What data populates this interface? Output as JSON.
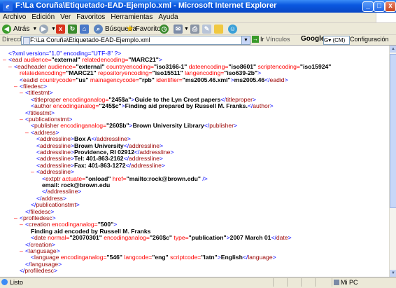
{
  "window": {
    "title": "F:\\La Coruña\\Etiquetado-EAD-Ejemplo.xml - Microsoft Internet Explorer",
    "app_icon": "e",
    "minimize": "_",
    "maximize": "□",
    "close": "x"
  },
  "menu": [
    "Archivo",
    "Edición",
    "Ver",
    "Favoritos",
    "Herramientas",
    "Ayuda"
  ],
  "toolbar": {
    "back_label": "Atrás",
    "search_label": "Búsqueda",
    "favorites_label": "Favoritos"
  },
  "address": {
    "label": "Dirección",
    "value": "F:\\La Coruña\\Etiquetado-EAD-Ejemplo.xml",
    "go_label": "Ir",
    "links_label": "Vínculos",
    "google_label": "Google",
    "google_search": "G▾ (CM)",
    "config_label": "Configuración"
  },
  "xml": {
    "l01": {
      "a": "<?xml version=\"1.0\" encoding=\"UTF-8\" ?>"
    },
    "l02": {
      "o": "<",
      "n": "ead",
      "a1": " audience=",
      "v1": "\"external\"",
      "a2": " relatedencoding=",
      "v2": "\"MARC21\"",
      "c": ">"
    },
    "l03": {
      "o": "<",
      "n": "eadheader",
      "a1": " audience=",
      "v1": "\"external\"",
      "a2": " countryencoding=",
      "v2": "\"iso3166-1\"",
      "a3": " dateencoding=",
      "v3": "\"iso8601\"",
      "a4": " scriptencoding=",
      "v4": "\"iso15924\""
    },
    "l04": {
      "a1": "relatedencoding=",
      "v1": "\"MARC21\"",
      "a2": " repositoryencoding=",
      "v2": "\"iso15511\"",
      "a3": " langencoding=",
      "v3": "\"iso639-2b\"",
      "c": ">"
    },
    "l05": {
      "o": "<",
      "n": "eadid",
      "a1": " countrycode=",
      "v1": "\"us\"",
      "a2": " mainagencycode=",
      "v2": "\"rpb\"",
      "a3": " identifier=",
      "v3": "\"ms2005.46.xml\"",
      "c": ">",
      "t": "ms2005.46",
      "eo": "</",
      "en": "eadid",
      "ec": ">"
    },
    "l06": {
      "o": "<",
      "n": "filedesc",
      "c": ">"
    },
    "l07": {
      "o": "<",
      "n": "titlestmt",
      "c": ">"
    },
    "l08": {
      "o": "<",
      "n": "titleproper",
      "a1": " encodinganalog=",
      "v1": "\"245$a\"",
      "c": ">",
      "t": "Guide to the Lyn Crost papers",
      "eo": "</",
      "en": "titleproper",
      "ec": ">"
    },
    "l09": {
      "o": "<",
      "n": "author",
      "a1": " encodinganalog=",
      "v1": "\"245$c\"",
      "c": ">",
      "t": "Finding aid prepared by Russell M. Franks.",
      "eo": "</",
      "en": "author",
      "ec": ">"
    },
    "l10": {
      "o": "</",
      "n": "titlestmt",
      "c": ">"
    },
    "l11": {
      "o": "<",
      "n": "publicationstmt",
      "c": ">"
    },
    "l12": {
      "o": "<",
      "n": "publisher",
      "a1": " encodinganalog=",
      "v1": "\"260$b\"",
      "c": ">",
      "t": "Brown University Library",
      "eo": "</",
      "en": "publisher",
      "ec": ">"
    },
    "l13": {
      "o": "<",
      "n": "address",
      "c": ">"
    },
    "l14": {
      "o": "<",
      "n": "addressline",
      "c": ">",
      "t": "Box A",
      "eo": "</",
      "en": "addressline",
      "ec": ">"
    },
    "l15": {
      "o": "<",
      "n": "addressline",
      "c": ">",
      "t": "Brown University",
      "eo": "</",
      "en": "addressline",
      "ec": ">"
    },
    "l16": {
      "o": "<",
      "n": "addressline",
      "c": ">",
      "t": "Providence, RI 02912",
      "eo": "</",
      "en": "addressline",
      "ec": ">"
    },
    "l17": {
      "o": "<",
      "n": "addressline",
      "c": ">",
      "t": "Tel: 401-863-2162",
      "eo": "</",
      "en": "addressline",
      "ec": ">"
    },
    "l18": {
      "o": "<",
      "n": "addressline",
      "c": ">",
      "t": "Fax: 401-863-1272",
      "eo": "</",
      "en": "addressline",
      "ec": ">"
    },
    "l19": {
      "o": "<",
      "n": "addressline",
      "c": ">"
    },
    "l20": {
      "o": "<",
      "n": "extptr",
      "a1": " actuate=",
      "v1": "\"onload\"",
      "a2": " href=",
      "v2": "\"mailto:rock@brown.edu\"",
      "c": " />"
    },
    "l21": {
      "t": "email: rock@brown.edu"
    },
    "l22": {
      "o": "</",
      "n": "addressline",
      "c": ">"
    },
    "l23": {
      "o": "</",
      "n": "address",
      "c": ">"
    },
    "l24": {
      "o": "</",
      "n": "publicationstmt",
      "c": ">"
    },
    "l25": {
      "o": "</",
      "n": "filedesc",
      "c": ">"
    },
    "l26": {
      "o": "<",
      "n": "profiledesc",
      "c": ">"
    },
    "l27": {
      "o": "<",
      "n": "creation",
      "a1": " encodinganalog=",
      "v1": "\"500\"",
      "c": ">"
    },
    "l28": {
      "t": "Finding aid encoded by Russell M. Franks"
    },
    "l29": {
      "o": "<",
      "n": "date",
      "a1": " normal=",
      "v1": "\"20070301\"",
      "a2": " encodinganalog=",
      "v2": "\"260$c\"",
      "a3": " type=",
      "v3": "\"publication\"",
      "c": ">",
      "t": "2007 March 01",
      "eo": "</",
      "en": "date",
      "ec": ">"
    },
    "l30": {
      "o": "</",
      "n": "creation",
      "c": ">"
    },
    "l31": {
      "o": "<",
      "n": "langusage",
      "c": ">"
    },
    "l32": {
      "o": "<",
      "n": "language",
      "a1": " encodinganalog=",
      "v1": "\"546\"",
      "a2": " langcode=",
      "v2": "\"eng\"",
      "a3": " scriptcode=",
      "v3": "\"latn\"",
      "c": ">",
      "t": "English",
      "eo": "</",
      "en": "language",
      "ec": ">"
    },
    "l33": {
      "o": "</",
      "n": "langusage",
      "c": ">"
    },
    "l34": {
      "o": "</",
      "n": "profiledesc",
      "c": ">"
    }
  },
  "collapse_marker": "–",
  "status": {
    "text": "Listo",
    "zone": "Mi PC"
  }
}
